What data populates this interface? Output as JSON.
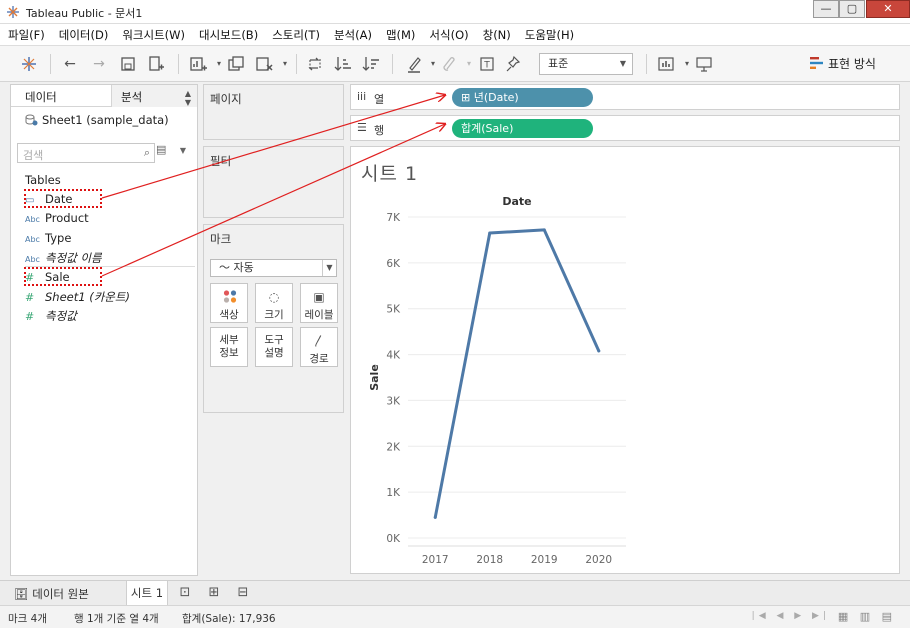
{
  "window": {
    "title": "Tableau Public - 문서1",
    "minimize": "—",
    "maximize": "▢",
    "close": "✕"
  },
  "menu": [
    "파일(F)",
    "데이터(D)",
    "워크시트(W)",
    "대시보드(B)",
    "스토리(T)",
    "분석(A)",
    "맵(M)",
    "서식(O)",
    "창(N)",
    "도움말(H)"
  ],
  "toolbar": {
    "fit_select": "표준",
    "show_me": "표현 방식",
    "icons": [
      "tableau-logo-icon",
      "undo-icon",
      "redo-icon",
      "save-icon",
      "new-datasource-icon",
      "new-worksheet-icon",
      "duplicate-icon",
      "clear-icon",
      "swap-icon",
      "sort-ascending-icon",
      "sort-descending-icon",
      "highlight-icon",
      "group-icon",
      "label-icon",
      "pin-icon",
      "chart-type-icon",
      "presentation-icon"
    ]
  },
  "data_pane": {
    "tab_data": "데이터",
    "tab_analysis": "분석",
    "datasource": "Sheet1 (sample_data)",
    "search_placeholder": "검색",
    "tables_label": "Tables",
    "fields": [
      {
        "icon": "date",
        "label": "Date"
      },
      {
        "icon": "Abc",
        "label": "Product"
      },
      {
        "icon": "Abc",
        "label": "Type"
      },
      {
        "icon": "Abc",
        "label": "측정값 이름"
      },
      {
        "icon": "#",
        "label": "Sale"
      },
      {
        "icon": "#",
        "label": "Sheet1 (카운트)"
      },
      {
        "icon": "#",
        "label": "측정값"
      }
    ]
  },
  "cards": {
    "pages": "페이지",
    "filters": "필터",
    "marks": "마크",
    "mark_type": "자동",
    "mark_buttons": [
      {
        "label": "색상",
        "icon": "color-icon"
      },
      {
        "label": "크기",
        "icon": "size-icon"
      },
      {
        "label": "레이블",
        "icon": "label-icon"
      },
      {
        "label": "세부\n정보",
        "icon": "detail-icon"
      },
      {
        "label": "도구\n설명",
        "icon": "tooltip-icon"
      },
      {
        "label": "경로",
        "icon": "path-icon"
      }
    ]
  },
  "shelves": {
    "columns_label": "열",
    "rows_label": "행",
    "columns_pill": "년(Date)",
    "rows_pill": "합계(Sale)"
  },
  "sheet_title": "시트 1",
  "chart_data": {
    "type": "line",
    "title": "Date",
    "xlabel": "Date",
    "ylabel": "Sale",
    "categories": [
      "2017",
      "2018",
      "2019",
      "2020"
    ],
    "values": [
      450,
      6650,
      6720,
      4080
    ],
    "ylim": [
      0,
      7000
    ],
    "yticks": [
      0,
      1000,
      2000,
      3000,
      4000,
      5000,
      6000,
      7000
    ],
    "ytick_labels": [
      "0K",
      "1K",
      "2K",
      "3K",
      "4K",
      "5K",
      "6K",
      "7K"
    ],
    "line_color": "#4e79a7",
    "grid": true
  },
  "bottom_tabs": {
    "datasource_tab": "데이터 원본",
    "sheet_tab": "시트 1"
  },
  "status": {
    "marks": "마크 4개",
    "rows_cols": "행 1개 기준 열 4개",
    "sum": "합계(Sale): 17,936"
  }
}
